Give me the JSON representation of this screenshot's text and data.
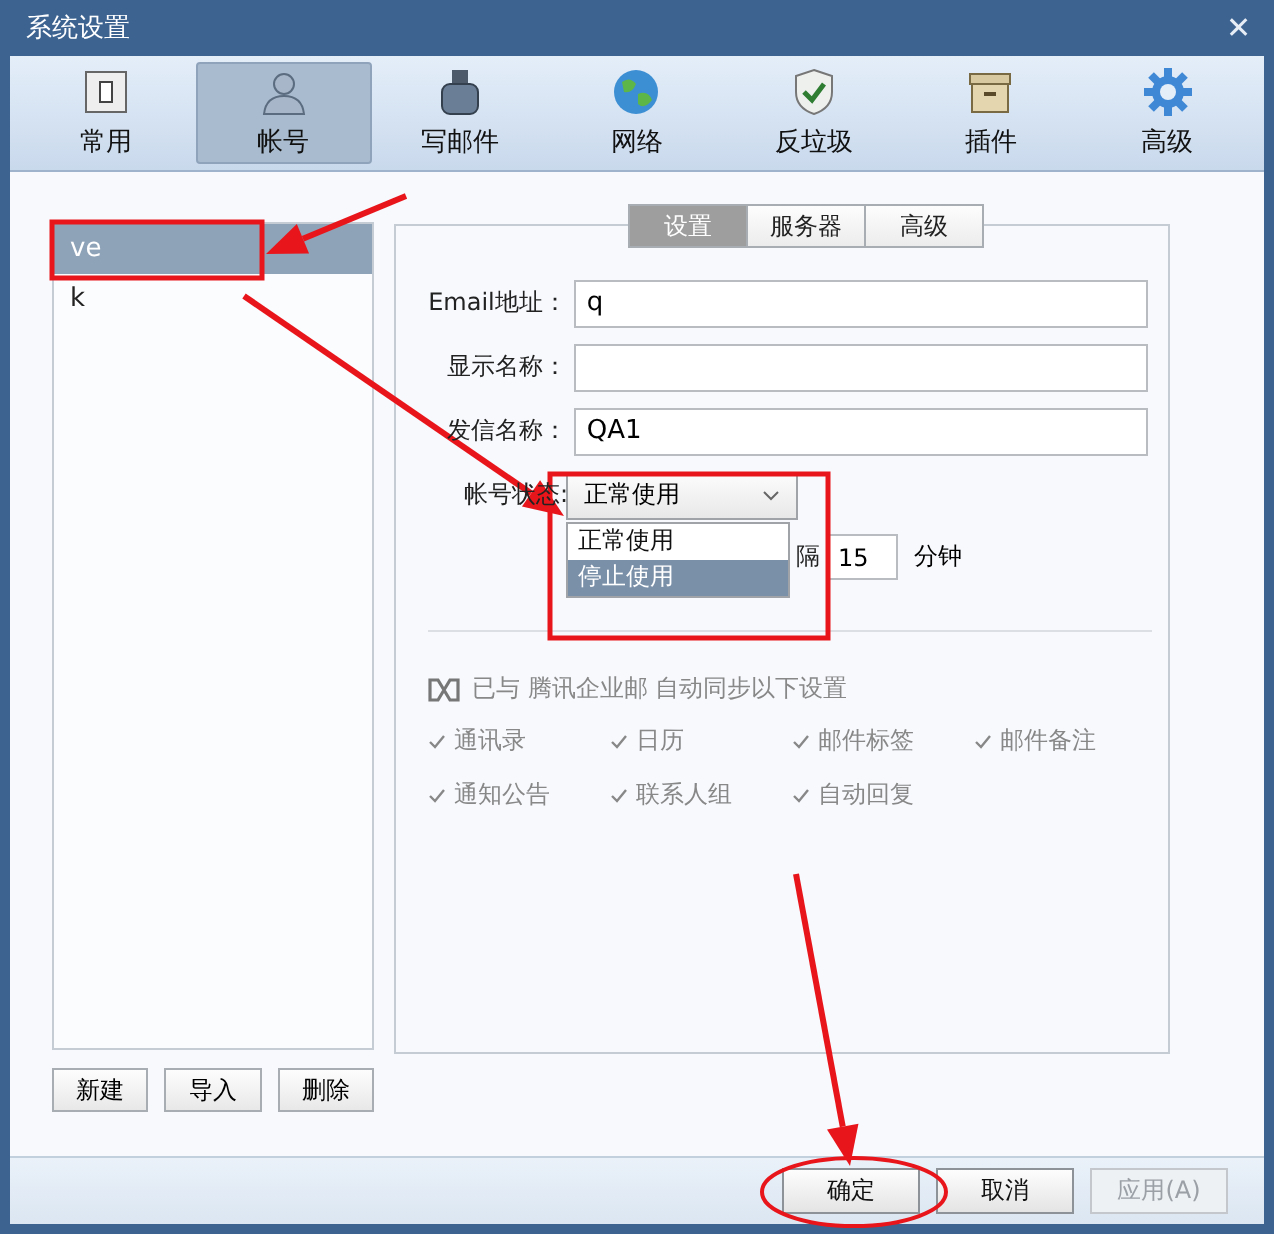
{
  "window": {
    "title": "系统设置",
    "close": "✕"
  },
  "toolbar": [
    {
      "label": "常用",
      "selected": false
    },
    {
      "label": "帐号",
      "selected": true
    },
    {
      "label": "写邮件",
      "selected": false
    },
    {
      "label": "网络",
      "selected": false
    },
    {
      "label": "反垃圾",
      "selected": false
    },
    {
      "label": "插件",
      "selected": false
    },
    {
      "label": "高级",
      "selected": false
    }
  ],
  "accounts": [
    {
      "name": "ve",
      "selected": true
    },
    {
      "name": "k",
      "selected": false
    }
  ],
  "account_buttons": [
    "新建",
    "导入",
    "删除"
  ],
  "tabs": [
    {
      "label": "设置",
      "selected": true
    },
    {
      "label": "服务器",
      "selected": false
    },
    {
      "label": "高级",
      "selected": false
    }
  ],
  "fields": [
    {
      "label": "Email地址：",
      "value": "q"
    },
    {
      "label": "显示名称："
    },
    {
      "label": "发信名称：",
      "value": "QA1"
    }
  ],
  "status": {
    "label": "帐号状态:",
    "value": "正常使用",
    "options": [
      {
        "label": "正常使用",
        "highlighted": false
      },
      {
        "label": "停止使用",
        "highlighted": true
      }
    ]
  },
  "interval": {
    "label": "隔",
    "value": "15",
    "unit": "分钟"
  },
  "sync": {
    "text": "已与 腾讯企业邮 自动同步以下设置",
    "items": [
      {
        "label": "通讯录",
        "checked": true
      },
      {
        "label": "日历",
        "checked": true
      },
      {
        "label": "邮件标签",
        "checked": true
      },
      {
        "label": "邮件备注",
        "checked": true
      },
      {
        "label": "通知公告",
        "checked": true
      },
      {
        "label": "联系人组",
        "checked": true
      },
      {
        "label": "自动回复",
        "checked": true
      }
    ]
  },
  "footer_buttons": [
    {
      "label": "确定",
      "disabled": false
    },
    {
      "label": "取消",
      "disabled": false
    },
    {
      "label": "应用(A)",
      "disabled": true
    }
  ]
}
